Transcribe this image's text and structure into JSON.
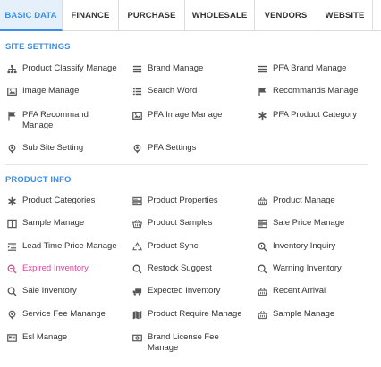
{
  "tabs": [
    {
      "label": "BASIC DATA",
      "active": true
    },
    {
      "label": "FINANCE"
    },
    {
      "label": "PURCHASE"
    },
    {
      "label": "WHOLESALE"
    },
    {
      "label": "VENDORS"
    },
    {
      "label": "WEBSITE"
    }
  ],
  "site_settings": {
    "title": "SITE SETTINGS",
    "items": [
      {
        "label": "Product Classify Manage",
        "icon": "sitemap-icon"
      },
      {
        "label": "Brand Manage",
        "icon": "list-icon"
      },
      {
        "label": "PFA Brand Manage",
        "icon": "list-icon"
      },
      {
        "label": "Image Manage",
        "icon": "image-icon"
      },
      {
        "label": "Search Word",
        "icon": "list-ol-icon"
      },
      {
        "label": "Recommands Manage",
        "icon": "flag-icon"
      },
      {
        "label": "PFA Recommand Manage",
        "icon": "flag-icon"
      },
      {
        "label": "PFA Image Manage",
        "icon": "image-icon"
      },
      {
        "label": "PFA Product Category",
        "icon": "asterisk-icon"
      },
      {
        "label": "Sub Site Setting",
        "icon": "map-pin-icon"
      },
      {
        "label": "PFA Settings",
        "icon": "map-pin-icon"
      }
    ]
  },
  "product_info": {
    "title": "PRODUCT INFO",
    "items": [
      {
        "label": "Product Categories",
        "icon": "asterisk-icon"
      },
      {
        "label": "Product Properties",
        "icon": "server-icon"
      },
      {
        "label": "Product Manage",
        "icon": "basket-icon"
      },
      {
        "label": "Sample Manage",
        "icon": "columns-icon"
      },
      {
        "label": "Product Samples",
        "icon": "basket-icon"
      },
      {
        "label": "Sale Price Manage",
        "icon": "server-icon"
      },
      {
        "label": "Lead Time Price Manage",
        "icon": "indent-icon"
      },
      {
        "label": "Product Sync",
        "icon": "recycle-icon"
      },
      {
        "label": "Inventory Inquiry",
        "icon": "search-plus-icon"
      },
      {
        "label": "Expired Inventory",
        "icon": "search-minus-icon",
        "highlight": true
      },
      {
        "label": "Restock Suggest",
        "icon": "search-icon"
      },
      {
        "label": "Warning Inventory",
        "icon": "search-icon"
      },
      {
        "label": "Sale Inventory",
        "icon": "search-icon"
      },
      {
        "label": "Expected Inventory",
        "icon": "truck-icon"
      },
      {
        "label": "Recent Arrival",
        "icon": "basket-icon"
      },
      {
        "label": "Service Fee Manange",
        "icon": "map-pin-icon"
      },
      {
        "label": "Product Require Manage",
        "icon": "map-icon"
      },
      {
        "label": "Sample Manage",
        "icon": "basket-icon"
      },
      {
        "label": "Esl Manage",
        "icon": "id-card-icon"
      },
      {
        "label": "Brand License Fee Manage",
        "icon": "money-icon"
      }
    ]
  },
  "colors": {
    "accent": "#3a8ee6",
    "highlight": "#d8489d",
    "active_tab_bg": "#e6f0fb"
  }
}
